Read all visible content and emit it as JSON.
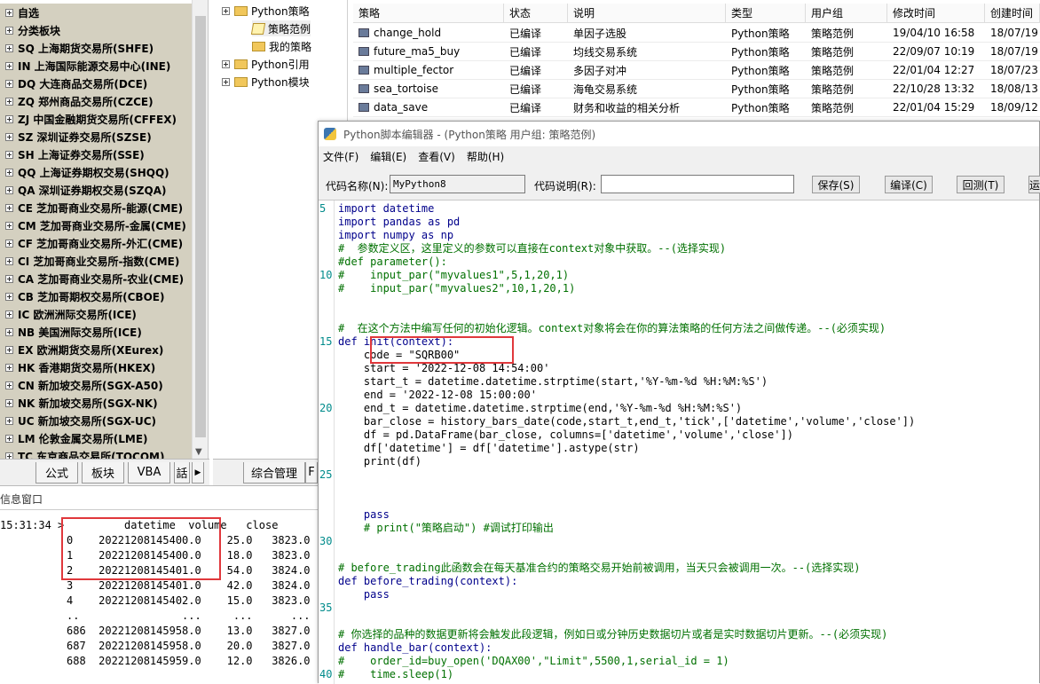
{
  "market_tree": [
    "自选",
    "分类板块",
    "SQ 上海期货交易所(SHFE)",
    "IN 上海国际能源交易中心(INE)",
    "DQ 大连商品交易所(DCE)",
    "ZQ 郑州商品交易所(CZCE)",
    "ZJ 中国金融期货交易所(CFFEX)",
    "SZ 深圳证券交易所(SZSE)",
    "SH 上海证券交易所(SSE)",
    "QQ 上海证券期权交易(SHQQ)",
    "QA 深圳证券期权交易(SZQA)",
    "CE 芝加哥商业交易所-能源(CME)",
    "CM 芝加哥商业交易所-金属(CME)",
    "CF 芝加哥商业交易所-外汇(CME)",
    "CI 芝加哥商业交易所-指数(CME)",
    "CA 芝加哥商业交易所-农业(CME)",
    "CB 芝加哥期权交易所(CBOE)",
    "IC 欧洲洲际交易所(ICE)",
    "NB 美国洲际交易所(ICE)",
    "EX 欧洲期货交易所(XEurex)",
    "HK 香港期货交易所(HKEX)",
    "CN 新加坡交易所(SGX-A50)",
    "NK 新加坡交易所(SGX-NK)",
    "UC 新加坡交易所(SGX-UC)",
    "LM 伦敦金属交易所(LME)",
    "TC 东京商品交易所(TOCOM)"
  ],
  "left_tabs": [
    "公式",
    "板块",
    "VBA",
    "話"
  ],
  "right_tabs": [
    "综合管理",
    "F"
  ],
  "info": {
    "title": "信息窗口",
    "timestamp": "15:31:34 >",
    "header": "         datetime  volume   close",
    "rows": [
      "0    20221208145400.0    25.0   3823.0",
      "1    20221208145400.0    18.0   3823.0",
      "2    20221208145401.0    54.0   3824.0",
      "3    20221208145401.0    42.0   3824.0",
      "4    20221208145402.0    15.0   3823.0",
      "..                ...     ...      ...",
      "686  20221208145958.0    13.0   3827.0",
      "687  20221208145958.0    20.0   3827.0",
      "688  20221208145959.0    12.0   3826.0"
    ]
  },
  "strategy_tree": {
    "root": "Python策略",
    "children": [
      "策略范例",
      "我的策略"
    ],
    "others": [
      "Python引用",
      "Python模块"
    ]
  },
  "table": {
    "headers": [
      "策略",
      "状态",
      "说明",
      "类型",
      "用户组",
      "修改时间",
      "创建时间"
    ],
    "rows": [
      [
        "change_hold",
        "已编译",
        "单因子选股",
        "Python策略",
        "策略范例",
        "19/04/10 16:58",
        "18/07/19"
      ],
      [
        "future_ma5_buy",
        "已编译",
        "均线交易系统",
        "Python策略",
        "策略范例",
        "22/09/07 10:19",
        "18/07/19"
      ],
      [
        "multiple_fector",
        "已编译",
        "多因子对冲",
        "Python策略",
        "策略范例",
        "22/01/04 12:27",
        "18/07/23"
      ],
      [
        "sea_tortoise",
        "已编译",
        "海龟交易系统",
        "Python策略",
        "策略范例",
        "22/10/28 13:32",
        "18/08/13"
      ],
      [
        "data_save",
        "已编译",
        "财务和收益的相关分析",
        "Python策略",
        "策略范例",
        "22/01/04 15:29",
        "18/09/12"
      ]
    ]
  },
  "editor": {
    "title": "Python脚本编辑器 - (Python策略 用户组: 策略范例)",
    "menu": [
      "文件(F)",
      "编辑(E)",
      "查看(V)",
      "帮助(H)"
    ],
    "name_label": "代码名称(N):",
    "name_value": "MyPython8",
    "desc_label": "代码说明(R):",
    "desc_value": "",
    "buttons": [
      "保存(S)",
      "编译(C)",
      "回测(T)",
      "运"
    ],
    "line_numbers": [
      "5",
      "10",
      "15",
      "20",
      "25",
      "30",
      "35",
      "40"
    ],
    "code": [
      "import datetime",
      "import pandas as pd",
      "import numpy as np",
      "#  参数定义区，这里定义的参数可以直接在context对象中获取。--(选择实现)",
      "#def parameter():",
      "#    input_par(\"myvalues1\",5,1,20,1)",
      "#    input_par(\"myvalues2\",10,1,20,1)",
      "",
      "",
      "#  在这个方法中编写任何的初始化逻辑。context对象将会在你的算法策略的任何方法之间做传递。--(必须实现)",
      "def init(context):",
      "    code = \"SQRB00\"",
      "    start = '2022-12-08 14:54:00'",
      "    start_t = datetime.datetime.strptime(start,'%Y-%m-%d %H:%M:%S')",
      "    end = '2022-12-08 15:00:00'",
      "    end_t = datetime.datetime.strptime(end,'%Y-%m-%d %H:%M:%S')",
      "    bar_close = history_bars_date(code,start_t,end_t,'tick',['datetime','volume','close'])",
      "    df = pd.DataFrame(bar_close, columns=['datetime','volume','close'])",
      "    df['datetime'] = df['datetime'].astype(str)",
      "    print(df)",
      "",
      "",
      "",
      "    pass",
      "    # print(\"策略启动\") #调试打印输出",
      "",
      "",
      "# before_trading此函数会在每天基准合约的策略交易开始前被调用，当天只会被调用一次。--(选择实现)",
      "def before_trading(context):",
      "    pass",
      "",
      "",
      "# 你选择的品种的数据更新将会触发此段逻辑，例如日或分钟历史数据切片或者是实时数据切片更新。--(必须实现)",
      "def handle_bar(context):",
      "#    order_id=buy_open('DQAX00',\"Limit\",5500,1,serial_id = 1)",
      "#    time.sleep(1)"
    ]
  }
}
